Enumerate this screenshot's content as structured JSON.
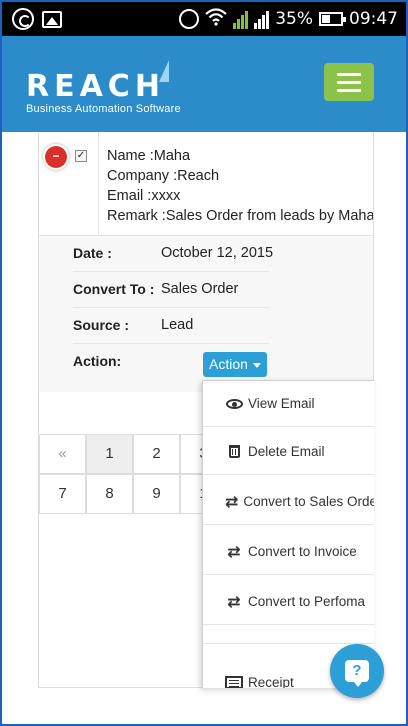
{
  "status_bar": {
    "icons": [
      "whatsapp-icon",
      "gallery-icon",
      "alarm-icon",
      "wifi-icon",
      "signal-icon",
      "signal-icon",
      "battery-icon"
    ],
    "battery": "35%",
    "time": "09:47"
  },
  "header": {
    "logo_word": "REACH",
    "logo_tagline": "Business Automation Software",
    "brand_color": "#2c8bc9",
    "menu_color": "#8bc34a"
  },
  "lead": {
    "name": "Name :Maha",
    "company": "Company :Reach",
    "email": "Email :xxxx",
    "remark": "Remark :Sales Order from leads by Maha"
  },
  "details": {
    "date_label": "Date :",
    "date_value": "October 12, 2015",
    "convert_label": "Convert To :",
    "convert_value": "Sales Order",
    "source_label": "Source :",
    "source_value": "Lead",
    "action_label": "Action:",
    "action_button": "Action"
  },
  "pagination": {
    "prev": "«",
    "row1": [
      "1",
      "2",
      "3"
    ],
    "row2": [
      "7",
      "8",
      "9",
      "1"
    ]
  },
  "action_menu": {
    "items": [
      {
        "label": "View Email",
        "icon": "eye-icon"
      },
      {
        "label": "Delete Email",
        "icon": "trash-icon"
      },
      {
        "label": "Convert to Sales Order",
        "icon": "retweet-icon"
      },
      {
        "label": "Convert to Invoice",
        "icon": "retweet-icon"
      },
      {
        "label": "Convert to Perfoma",
        "icon": "retweet-icon"
      },
      {
        "label": "Receipt",
        "icon": "receipt-icon"
      }
    ]
  },
  "help_button": {
    "glyph": "?",
    "color": "#2c9fd6"
  }
}
